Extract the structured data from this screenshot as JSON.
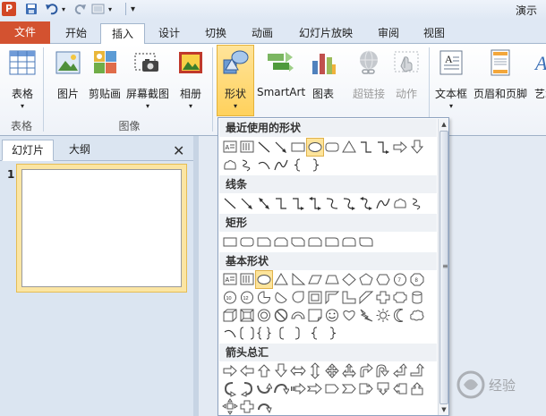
{
  "window": {
    "app_badge": "P",
    "title": "演示"
  },
  "tabs": [
    {
      "label": "文件"
    },
    {
      "label": "开始"
    },
    {
      "label": "插入"
    },
    {
      "label": "设计"
    },
    {
      "label": "切换"
    },
    {
      "label": "动画"
    },
    {
      "label": "幻灯片放映"
    },
    {
      "label": "审阅"
    },
    {
      "label": "视图"
    }
  ],
  "ribbon": {
    "table": {
      "label": "表格"
    },
    "picture": {
      "label": "图片"
    },
    "clipart": {
      "label": "剪贴画"
    },
    "screenshot": {
      "label": "屏幕截图"
    },
    "album": {
      "label": "相册"
    },
    "shapes": {
      "label": "形状"
    },
    "smartart": {
      "label": "SmartArt"
    },
    "chart": {
      "label": "图表"
    },
    "hyperlink": {
      "label": "超链接"
    },
    "action": {
      "label": "动作"
    },
    "textbox": {
      "label": "文本框"
    },
    "header_footer": {
      "label": "页眉和页脚"
    },
    "wordart": {
      "label": "艺术"
    },
    "groups": {
      "tables": "表格",
      "images": "图像"
    }
  },
  "slide_pane": {
    "tab_slides": "幻灯片",
    "tab_outline": "大纲",
    "close_glyph": "✕",
    "slide_number": "1"
  },
  "shapes_menu": {
    "categories": {
      "recent": "最近使用的形状",
      "lines": "线条",
      "rectangles": "矩形",
      "basic": "基本形状",
      "arrows": "箭头总汇"
    }
  },
  "watermark": "经验"
}
